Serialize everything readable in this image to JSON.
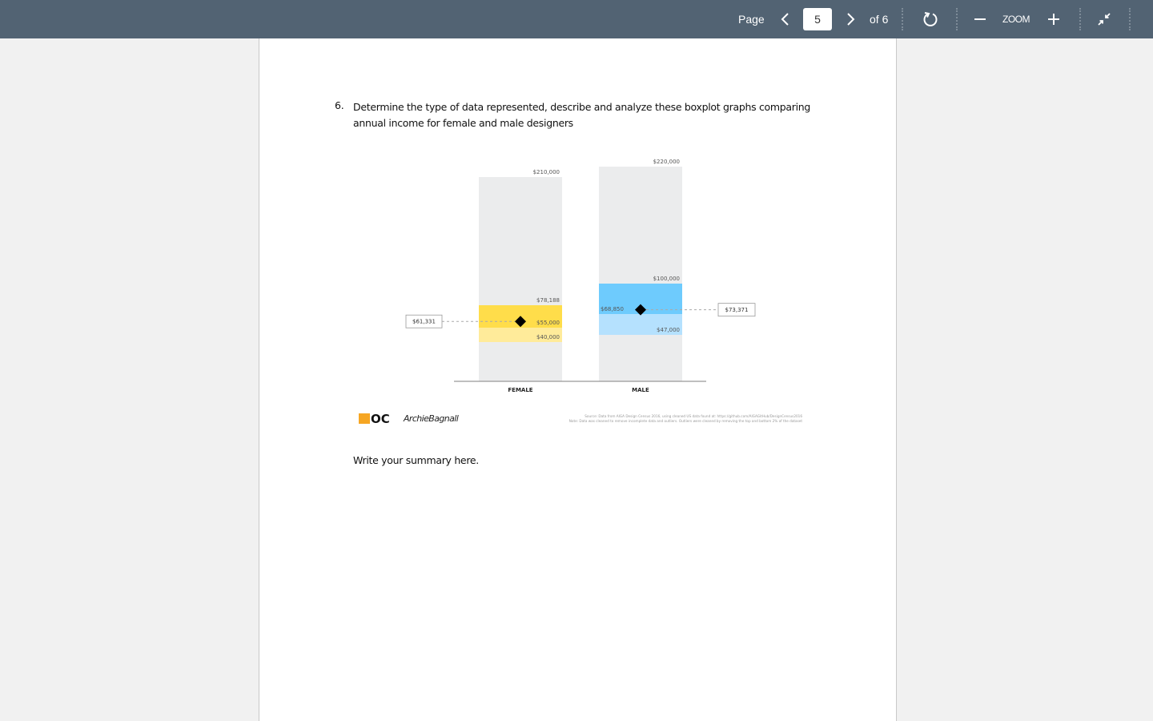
{
  "toolbar": {
    "page_label": "Page",
    "current_page": "5",
    "page_count_label": "of 6",
    "zoom_label": "ZOOM",
    "icons": [
      "chevron-left-icon",
      "chevron-right-icon",
      "rotate-icon",
      "zoom-out-icon",
      "zoom-in-icon",
      "exit-fullscreen-icon"
    ]
  },
  "document": {
    "question_number": "6.",
    "question_text": "Determine the type of data represented, describe and analyze these boxplot graphs comparing annual income for female and male designers",
    "summary_prompt": "Write your summary here."
  },
  "chart_data": {
    "type": "boxplot",
    "title": "",
    "xlabel": "",
    "ylabel": "",
    "ylim": [
      0,
      220000
    ],
    "grid": false,
    "colors": {
      "range_bar": "#ebeced",
      "female_upper": "#ffdd4a",
      "female_lower": "#ffeb9a",
      "male_upper": "#6ecbfd",
      "male_lower": "#b5e1fe",
      "mean_marker": "#000000"
    },
    "categories": [
      "FEMALE",
      "MALE"
    ],
    "series": [
      {
        "name": "FEMALE",
        "max": 210000,
        "max_label": "$210,000",
        "q3": 78188,
        "q3_label": "$78,188",
        "median": 55000,
        "median_label": "$55,000",
        "q1": 40000,
        "q1_label": "$40,000",
        "mean": 61331,
        "mean_label": "$61,331",
        "mean_label_side": "left"
      },
      {
        "name": "MALE",
        "max": 220000,
        "max_label": "$220,000",
        "q3": 100000,
        "q3_label": "$100,000",
        "median": 68850,
        "median_label": "$68,850",
        "q1": 47000,
        "q1_label": "$47,000",
        "mean": 73371,
        "mean_label": "$73,371",
        "mean_label_side": "right"
      }
    ],
    "logos": [
      "OC",
      "ArchieBagnall"
    ],
    "source_lines": [
      "Source: Data from AIGA Design Census 2016, using cleaned US data found at: https://github.com/AIGAGitHub/DesignCensus2016",
      "Note: Data was cleaned to remove incomplete data and outliers. Outliers were cleaned by removing the top and bottom 2% of the dataset"
    ]
  }
}
